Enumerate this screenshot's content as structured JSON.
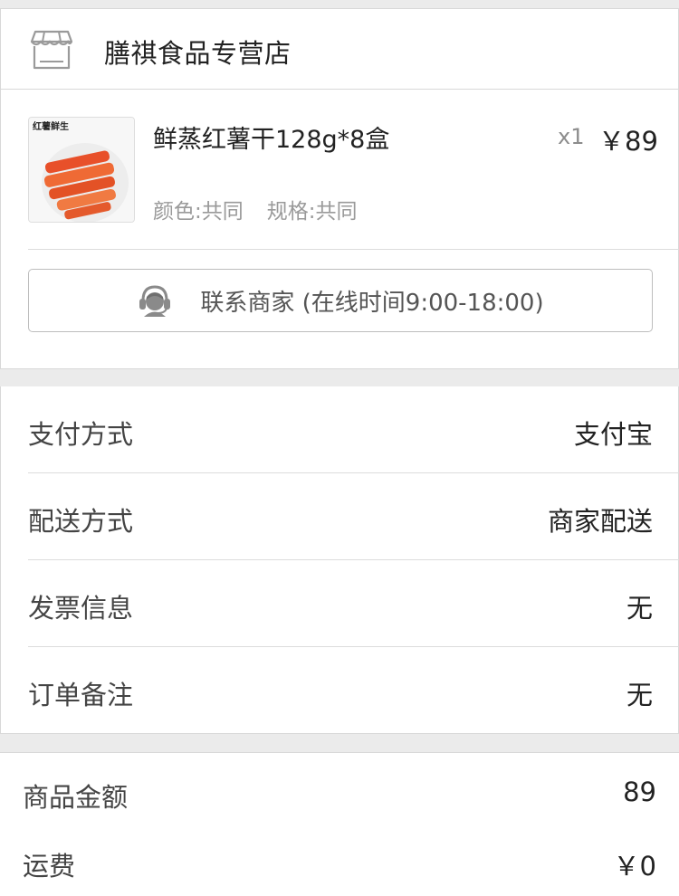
{
  "store": {
    "name": "膳祺食品专营店"
  },
  "product": {
    "thumb_text": "红薯鲜生",
    "title": "鲜蒸红薯干128g*8盒",
    "color_spec": "颜色:共同",
    "size_spec": "规格:共同",
    "quantity": "x1",
    "price": "￥89"
  },
  "contact": {
    "label": "联系商家 (在线时间9:00-18:00)"
  },
  "info": [
    {
      "label": "支付方式",
      "value": "支付宝"
    },
    {
      "label": "配送方式",
      "value": "商家配送"
    },
    {
      "label": "发票信息",
      "value": "无"
    },
    {
      "label": "订单备注",
      "value": "无"
    }
  ],
  "summary": [
    {
      "label": "商品金额",
      "value": "89"
    },
    {
      "label": "运费",
      "value": "￥0"
    }
  ],
  "colors": {
    "background": "#ebebeb",
    "card": "#ffffff",
    "text_primary": "#222222",
    "text_secondary": "#9a9a9a",
    "divider": "#dcdcdc"
  }
}
